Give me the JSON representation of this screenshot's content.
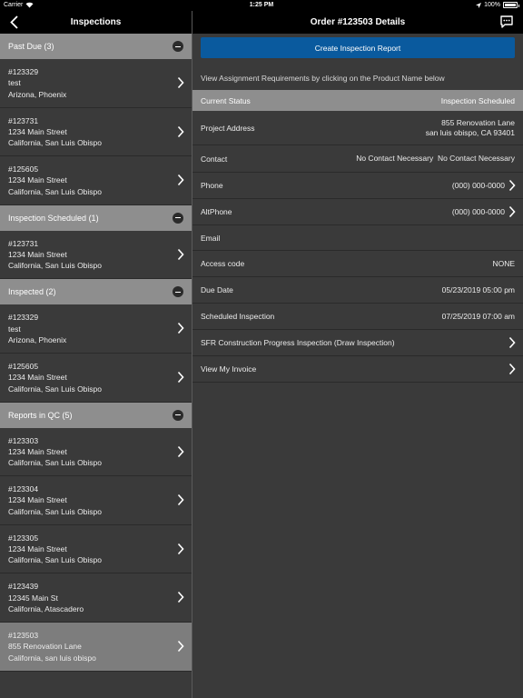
{
  "status_bar": {
    "carrier": "Carrier",
    "time": "1:25 PM",
    "battery": "100%"
  },
  "left": {
    "title": "Inspections",
    "sections": [
      {
        "label": "Past Due (3)",
        "items": [
          {
            "lines": [
              "#123329",
              "test",
              "Arizona, Phoenix"
            ]
          },
          {
            "lines": [
              "#123731",
              "1234 Main Street",
              "California, San Luis Obispo"
            ]
          },
          {
            "lines": [
              "#125605",
              "1234 Main Street",
              "California, San Luis Obispo"
            ]
          }
        ]
      },
      {
        "label": "Inspection Scheduled (1)",
        "items": [
          {
            "lines": [
              "#123731",
              "1234 Main Street",
              "California, San Luis Obispo"
            ]
          }
        ]
      },
      {
        "label": "Inspected (2)",
        "items": [
          {
            "lines": [
              "#123329",
              "test",
              "Arizona, Phoenix"
            ]
          },
          {
            "lines": [
              "#125605",
              "1234 Main Street",
              "California, San Luis Obispo"
            ]
          }
        ]
      },
      {
        "label": "Reports in QC (5)",
        "items": [
          {
            "lines": [
              "#123303",
              "1234 Main Street",
              "California, San Luis Obispo"
            ]
          },
          {
            "lines": [
              "#123304",
              "1234 Main Street",
              "California, San Luis Obispo"
            ]
          },
          {
            "lines": [
              "#123305",
              "1234 Main Street",
              "California, San Luis Obispo"
            ]
          },
          {
            "lines": [
              "#123439",
              "12345 Main St",
              "California, Atascadero"
            ]
          },
          {
            "lines": [
              "#123503",
              "855 Renovation Lane",
              "California, san luis obispo"
            ],
            "selected": true
          }
        ]
      }
    ]
  },
  "right": {
    "title": "Order #123503 Details",
    "create_button": "Create Inspection Report",
    "hint": "View Assignment Requirements by clicking on the Product Name below",
    "current_status": {
      "label": "Current Status",
      "value": "Inspection Scheduled"
    },
    "project_address": {
      "label": "Project Address",
      "line1": "855 Renovation Lane",
      "line2": "san luis obispo, CA 93401"
    },
    "contact": {
      "label": "Contact",
      "value": "No Contact Necessary  No Contact Necessary"
    },
    "phone": {
      "label": "Phone",
      "value": "(000) 000-0000"
    },
    "altphone": {
      "label": "AltPhone",
      "value": "(000) 000-0000"
    },
    "email": {
      "label": "Email",
      "value": ""
    },
    "access_code": {
      "label": "Access code",
      "value": "NONE"
    },
    "due_date": {
      "label": "Due Date",
      "value": "05/23/2019 05:00 pm"
    },
    "scheduled": {
      "label": "Scheduled Inspection",
      "value": "07/25/2019 07:00 am"
    },
    "product": {
      "label": "SFR Construction Progress Inspection (Draw Inspection)"
    },
    "invoice": {
      "label": "View My Invoice"
    }
  },
  "colors": {
    "accent": "#0a5a9e",
    "section_header": "#8e8e8e",
    "background": "#3a3a3a",
    "selected_row": "#7d7d7d"
  }
}
